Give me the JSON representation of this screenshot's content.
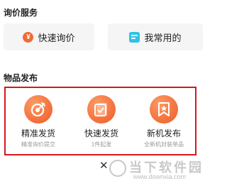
{
  "inquiry_section": {
    "title": "询价服务",
    "quick_inquiry_label": "快速询价",
    "quick_inquiry_icon": "yen-icon",
    "my_common_label": "我常用的",
    "my_common_icon": "chat-list-icon"
  },
  "publish_section": {
    "title": "物品发布",
    "items": [
      {
        "label": "精准发货",
        "sub": "精准询价提交",
        "icon": "target-icon"
      },
      {
        "label": "快速发货",
        "sub": "1件起发",
        "icon": "checkbox-icon"
      },
      {
        "label": "新机发布",
        "sub": "全新机封装单品",
        "icon": "bookmark-star-icon"
      }
    ]
  },
  "watermark": {
    "name": "当下软件园",
    "url": "www.downxia.com"
  },
  "colors": {
    "accent_orange": "#ef5a26",
    "highlight_red": "#d6171e",
    "chat_blue": "#2fc3e6"
  }
}
